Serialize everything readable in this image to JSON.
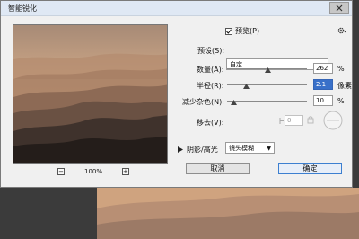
{
  "dialog": {
    "title": "智能锐化",
    "close_icon": "close-icon"
  },
  "preview": {
    "checkbox_checked": true,
    "label": "预览(P)",
    "zoom_out_glyph": "−",
    "zoom_in_glyph": "+",
    "zoom_level": "100%"
  },
  "presets": {
    "label": "预设(S):",
    "value": "自定"
  },
  "controls": [
    {
      "label": "数量(A):",
      "value": "262",
      "unit": "%",
      "level": 0.52
    },
    {
      "label": "半径(R):",
      "value": "2.1",
      "unit": "像素",
      "level": 0.22
    },
    {
      "label": "减少杂色(N):",
      "value": "10",
      "unit": "%",
      "level": 0.08
    }
  ],
  "remove": {
    "label": "移去(V):",
    "value": "镜头模糊",
    "angle_value": "0"
  },
  "shadows_highlights": {
    "label": "阴影/高光"
  },
  "buttons": {
    "cancel": "取消",
    "ok": "确定"
  },
  "colors": {
    "accent": "#3c7fd0",
    "field_active": "#3970c9",
    "photo_sky": "#d6aa83",
    "photo_dark": "#2a2320"
  }
}
